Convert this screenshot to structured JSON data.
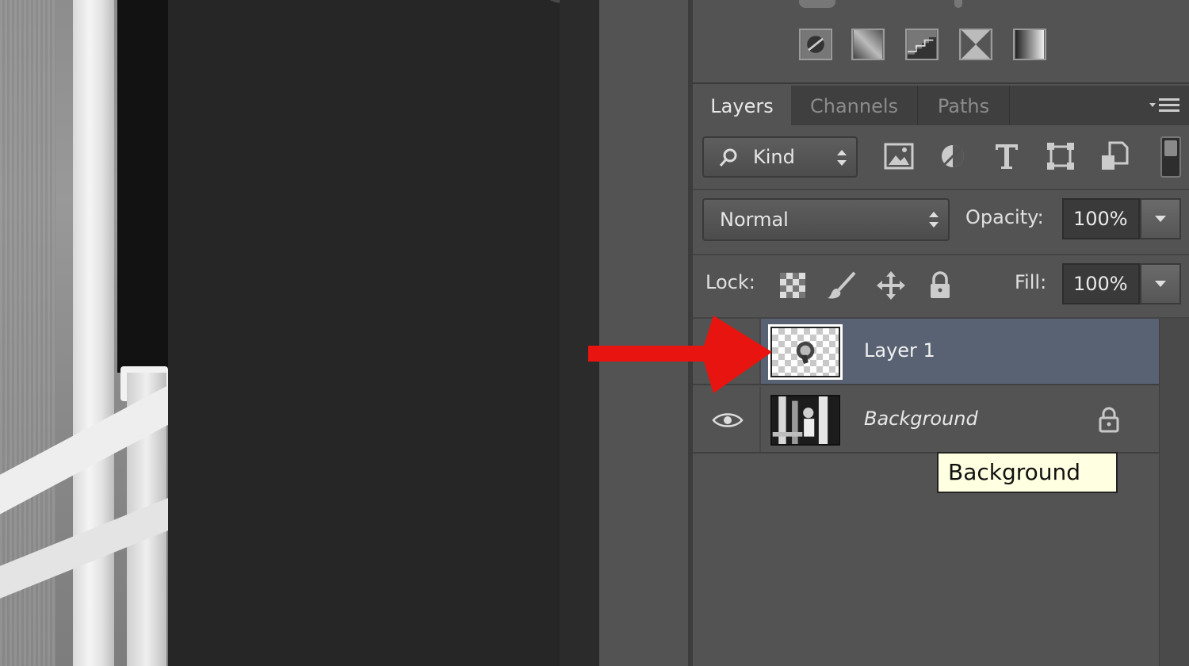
{
  "tabs": [
    {
      "label": "Layers",
      "active": true
    },
    {
      "label": "Channels",
      "active": false
    },
    {
      "label": "Paths",
      "active": false
    }
  ],
  "filter": {
    "kind_label": "Kind",
    "icons": [
      "image-filter-icon",
      "adjustment-filter-icon",
      "type-filter-icon",
      "shape-filter-icon",
      "smart-object-filter-icon"
    ]
  },
  "blend": {
    "mode": "Normal",
    "opacity_label": "Opacity:",
    "opacity_value": "100%"
  },
  "lock": {
    "label": "Lock:",
    "fill_label": "Fill:",
    "fill_value": "100%",
    "icons": [
      "lock-transparent-pixels-icon",
      "lock-image-pixels-icon",
      "lock-position-icon",
      "lock-all-icon"
    ]
  },
  "layers": [
    {
      "name": "Layer 1",
      "selected": true,
      "visible": false
    },
    {
      "name": "Background",
      "selected": false,
      "visible": true,
      "locked": true
    }
  ],
  "tooltip": "Background",
  "annotation_color": "#e8140f"
}
